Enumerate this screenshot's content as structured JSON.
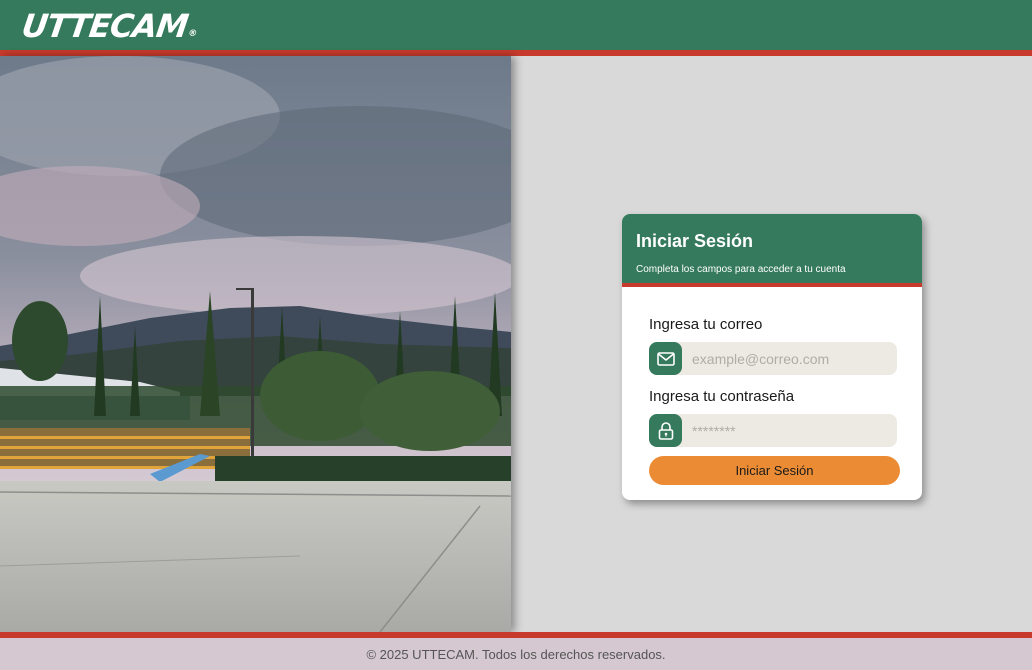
{
  "header": {
    "logo_text": "UTTECAM",
    "logo_mark": "®"
  },
  "photo": {
    "icon": "campus-photo"
  },
  "login": {
    "title": "Iniciar Sesión",
    "subtitle": "Completa los campos para acceder a tu cuenta",
    "email_label": "Ingresa tu correo",
    "email_placeholder": "example@correo.com",
    "email_icon": "mail-icon",
    "password_label": "Ingresa tu contraseña",
    "password_placeholder": "********",
    "password_icon": "lock-icon",
    "submit_label": "Iniciar Sesión"
  },
  "footer": {
    "text": "© 2025 UTTECAM. Todos los derechos reservados."
  },
  "colors": {
    "primary_green": "#357a5c",
    "accent_red": "#c83a2c",
    "button_orange": "#eb8c35",
    "background": "#d9d9d9",
    "footer_bg": "#d5c8d1"
  }
}
